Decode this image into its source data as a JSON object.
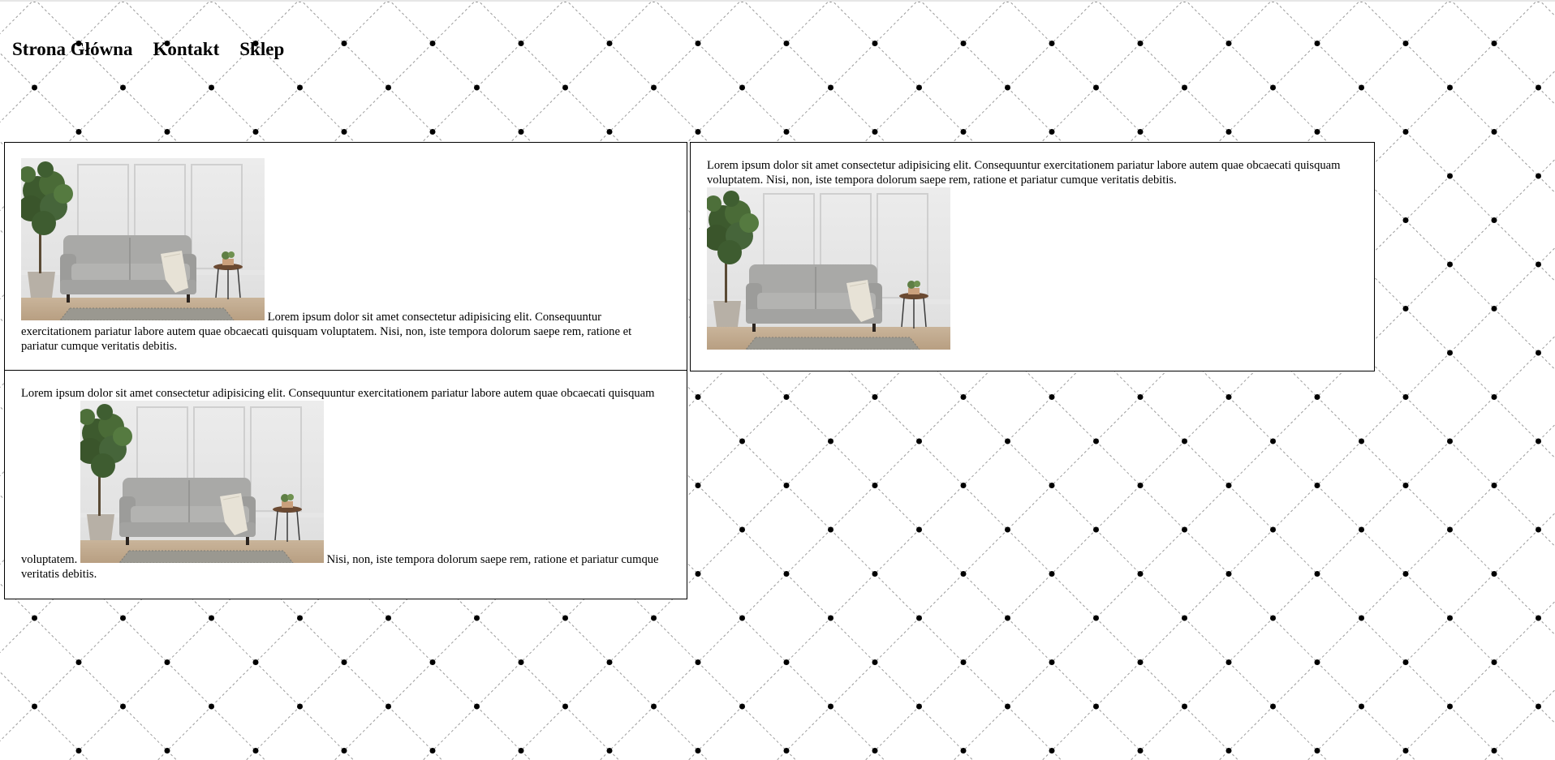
{
  "nav": {
    "home": "Strona Główna",
    "contact": "Kontakt",
    "shop": "Sklep"
  },
  "cards": [
    {
      "text": "Lorem ipsum dolor sit amet consectetur adipisicing elit. Consequuntur exercitationem pariatur labore autem quae obcaecati quisquam voluptatem. Nisi, non, iste tempora dolorum saepe rem, ratione et pariatur cumque veritatis debitis.",
      "image": "sofa-living-room-photo"
    },
    {
      "text": "Lorem ipsum dolor sit amet consectetur adipisicing elit. Consequuntur exercitationem pariatur labore autem quae obcaecati quisquam voluptatem. Nisi, non, iste tempora dolorum saepe rem, ratione et pariatur cumque veritatis debitis.",
      "image": "sofa-living-room-photo"
    },
    {
      "text_before": "Lorem ipsum dolor sit amet consectetur adipisicing elit. Consequuntur exercitationem pariatur labore autem quae obcaecati quisquam voluptatem.",
      "text_after": "Nisi, non, iste tempora dolorum saepe rem, ratione et pariatur cumque veritatis debitis.",
      "image": "sofa-living-room-photo"
    }
  ],
  "colors": {
    "background": "#ffffff",
    "pattern_dot": "#000000",
    "pattern_line": "#9a9a9a",
    "card_border": "#000000"
  }
}
